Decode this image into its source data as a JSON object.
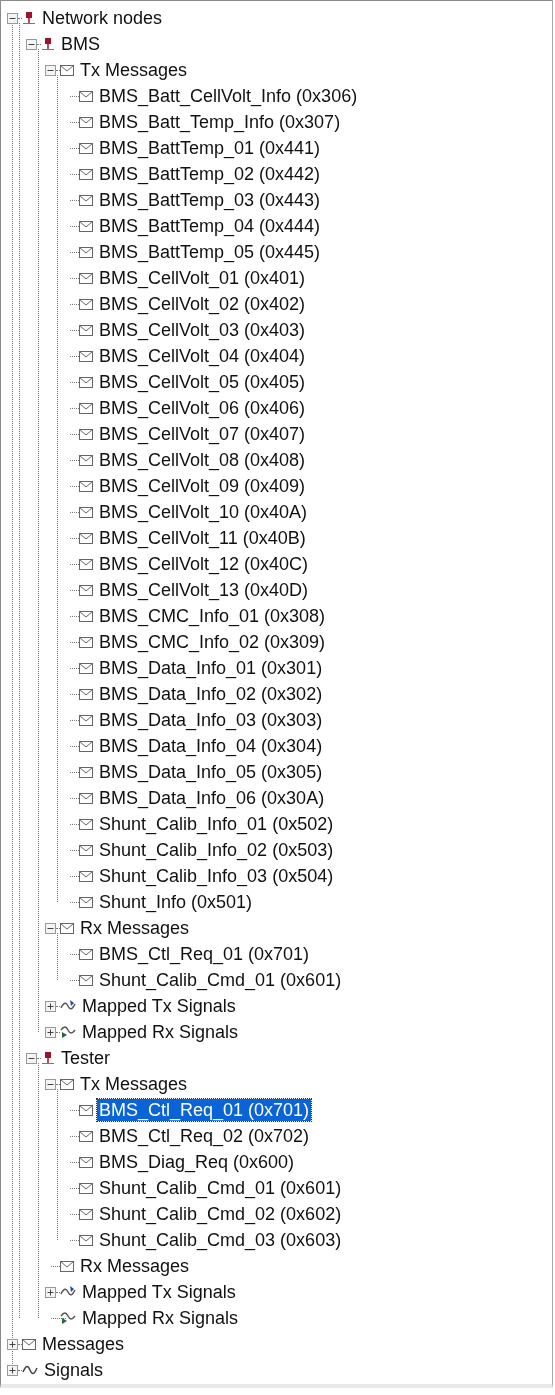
{
  "tree": [
    {
      "label": "Network nodes",
      "kind": "node",
      "expanded": true,
      "selected": false,
      "children": [
        {
          "label": "BMS",
          "kind": "node",
          "expanded": true,
          "selected": false,
          "children": [
            {
              "label": "Tx Messages",
              "kind": "message",
              "expanded": true,
              "selected": false,
              "children": [
                {
                  "label": "BMS_Batt_CellVolt_Info (0x306)",
                  "kind": "message",
                  "selected": false
                },
                {
                  "label": "BMS_Batt_Temp_Info (0x307)",
                  "kind": "message",
                  "selected": false
                },
                {
                  "label": "BMS_BattTemp_01 (0x441)",
                  "kind": "message",
                  "selected": false
                },
                {
                  "label": "BMS_BattTemp_02 (0x442)",
                  "kind": "message",
                  "selected": false
                },
                {
                  "label": "BMS_BattTemp_03 (0x443)",
                  "kind": "message",
                  "selected": false
                },
                {
                  "label": "BMS_BattTemp_04 (0x444)",
                  "kind": "message",
                  "selected": false
                },
                {
                  "label": "BMS_BattTemp_05 (0x445)",
                  "kind": "message",
                  "selected": false
                },
                {
                  "label": "BMS_CellVolt_01 (0x401)",
                  "kind": "message",
                  "selected": false
                },
                {
                  "label": "BMS_CellVolt_02 (0x402)",
                  "kind": "message",
                  "selected": false
                },
                {
                  "label": "BMS_CellVolt_03 (0x403)",
                  "kind": "message",
                  "selected": false
                },
                {
                  "label": "BMS_CellVolt_04 (0x404)",
                  "kind": "message",
                  "selected": false
                },
                {
                  "label": "BMS_CellVolt_05 (0x405)",
                  "kind": "message",
                  "selected": false
                },
                {
                  "label": "BMS_CellVolt_06 (0x406)",
                  "kind": "message",
                  "selected": false
                },
                {
                  "label": "BMS_CellVolt_07 (0x407)",
                  "kind": "message",
                  "selected": false
                },
                {
                  "label": "BMS_CellVolt_08 (0x408)",
                  "kind": "message",
                  "selected": false
                },
                {
                  "label": "BMS_CellVolt_09 (0x409)",
                  "kind": "message",
                  "selected": false
                },
                {
                  "label": "BMS_CellVolt_10 (0x40A)",
                  "kind": "message",
                  "selected": false
                },
                {
                  "label": "BMS_CellVolt_11 (0x40B)",
                  "kind": "message",
                  "selected": false
                },
                {
                  "label": "BMS_CellVolt_12 (0x40C)",
                  "kind": "message",
                  "selected": false
                },
                {
                  "label": "BMS_CellVolt_13 (0x40D)",
                  "kind": "message",
                  "selected": false
                },
                {
                  "label": "BMS_CMC_Info_01 (0x308)",
                  "kind": "message",
                  "selected": false
                },
                {
                  "label": "BMS_CMC_Info_02 (0x309)",
                  "kind": "message",
                  "selected": false
                },
                {
                  "label": "BMS_Data_Info_01 (0x301)",
                  "kind": "message",
                  "selected": false
                },
                {
                  "label": "BMS_Data_Info_02 (0x302)",
                  "kind": "message",
                  "selected": false
                },
                {
                  "label": "BMS_Data_Info_03 (0x303)",
                  "kind": "message",
                  "selected": false
                },
                {
                  "label": "BMS_Data_Info_04 (0x304)",
                  "kind": "message",
                  "selected": false
                },
                {
                  "label": "BMS_Data_Info_05 (0x305)",
                  "kind": "message",
                  "selected": false
                },
                {
                  "label": "BMS_Data_Info_06 (0x30A)",
                  "kind": "message",
                  "selected": false
                },
                {
                  "label": "Shunt_Calib_Info_01 (0x502)",
                  "kind": "message",
                  "selected": false
                },
                {
                  "label": "Shunt_Calib_Info_02 (0x503)",
                  "kind": "message",
                  "selected": false
                },
                {
                  "label": "Shunt_Calib_Info_03 (0x504)",
                  "kind": "message",
                  "selected": false
                },
                {
                  "label": "Shunt_Info (0x501)",
                  "kind": "message",
                  "selected": false
                }
              ]
            },
            {
              "label": "Rx Messages",
              "kind": "message",
              "expanded": true,
              "selected": false,
              "children": [
                {
                  "label": "BMS_Ctl_Req_01 (0x701)",
                  "kind": "message",
                  "selected": false
                },
                {
                  "label": "Shunt_Calib_Cmd_01 (0x601)",
                  "kind": "message",
                  "selected": false
                }
              ]
            },
            {
              "label": "Mapped Tx Signals",
              "kind": "tx-signals",
              "expanded": false,
              "selected": false
            },
            {
              "label": "Mapped Rx Signals",
              "kind": "rx-signals",
              "expanded": false,
              "selected": false
            }
          ]
        },
        {
          "label": "Tester",
          "kind": "node",
          "expanded": true,
          "selected": false,
          "children": [
            {
              "label": "Tx Messages",
              "kind": "message",
              "expanded": true,
              "selected": false,
              "children": [
                {
                  "label": "BMS_Ctl_Req_01 (0x701)",
                  "kind": "message",
                  "selected": true
                },
                {
                  "label": "BMS_Ctl_Req_02 (0x702)",
                  "kind": "message",
                  "selected": false
                },
                {
                  "label": "BMS_Diag_Req (0x600)",
                  "kind": "message",
                  "selected": false
                },
                {
                  "label": "Shunt_Calib_Cmd_01 (0x601)",
                  "kind": "message",
                  "selected": false
                },
                {
                  "label": "Shunt_Calib_Cmd_02 (0x602)",
                  "kind": "message",
                  "selected": false
                },
                {
                  "label": "Shunt_Calib_Cmd_03 (0x603)",
                  "kind": "message",
                  "selected": false
                }
              ]
            },
            {
              "label": "Rx Messages",
              "kind": "message",
              "selected": false
            },
            {
              "label": "Mapped Tx Signals",
              "kind": "tx-signals",
              "expanded": false,
              "selected": false
            },
            {
              "label": "Mapped Rx Signals",
              "kind": "rx-signals",
              "selected": false
            }
          ]
        }
      ]
    },
    {
      "label": "Messages",
      "kind": "message",
      "expanded": false,
      "selected": false
    },
    {
      "label": "Signals",
      "kind": "wave",
      "expanded": false,
      "selected": false
    }
  ]
}
